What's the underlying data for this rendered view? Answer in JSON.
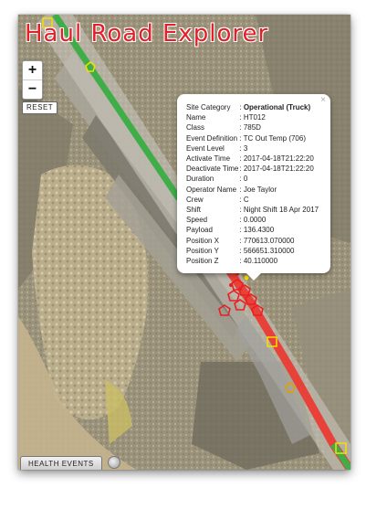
{
  "app": {
    "title": "Haul Road Explorer"
  },
  "controls": {
    "zoom_in": "+",
    "zoom_out": "−",
    "reset_label": "RESET"
  },
  "popup": {
    "close": "×",
    "rows": [
      {
        "label": "Site Category",
        "value": "Operational (Truck)",
        "bold": true
      },
      {
        "label": "Name",
        "value": "HT012"
      },
      {
        "label": "Class",
        "value": "785D"
      },
      {
        "label": "Event Definition",
        "value": "TC Out Temp (706)"
      },
      {
        "label": "Event Level",
        "value": "3"
      },
      {
        "label": "Activate Time",
        "value": "2017-04-18T21:22:20"
      },
      {
        "label": "Deactivate Time",
        "value": "2017-04-18T21:22:20"
      },
      {
        "label": "Duration",
        "value": "0"
      },
      {
        "label": "Operator Name",
        "value": "Joe Taylor"
      },
      {
        "label": "Crew",
        "value": "C"
      },
      {
        "label": "Shift",
        "value": "Night Shift 18 Apr 2017"
      },
      {
        "label": "Speed",
        "value": "0.0000"
      },
      {
        "label": "Payload",
        "value": "136.4300"
      },
      {
        "label": "Position X",
        "value": "770613.070000"
      },
      {
        "label": "Position Y",
        "value": "566651.310000"
      },
      {
        "label": "Position Z",
        "value": "40.110000"
      }
    ]
  },
  "bottom": {
    "health_events_label": "HEALTH EVENTS"
  },
  "colors": {
    "title": "#e3202a",
    "road_ok": "#3fae49",
    "road_alert": "#e8413a",
    "marker": "#f0e000",
    "event_marker": "#e82020"
  }
}
